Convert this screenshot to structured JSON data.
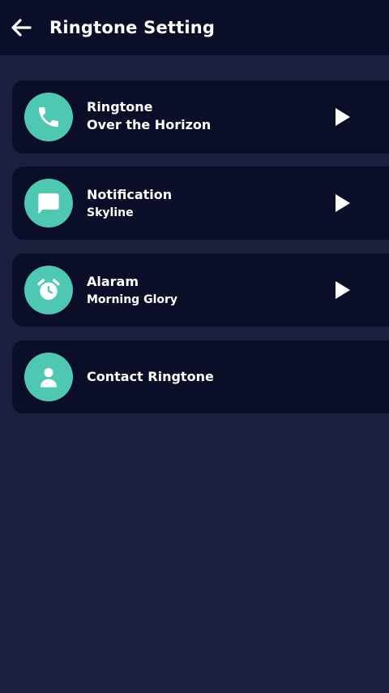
{
  "header": {
    "title": "Ringtone Setting"
  },
  "items": [
    {
      "label": "Ringtone",
      "value": "Over the Horizon"
    },
    {
      "label": "Notification",
      "value": "Skyline"
    },
    {
      "label": "Alaram",
      "value": "Morning Glory"
    },
    {
      "label": "Contact Ringtone"
    }
  ],
  "colors": {
    "background": "#1d1f3f",
    "card": "#0b0e29",
    "accent": "#4ec8b1"
  }
}
